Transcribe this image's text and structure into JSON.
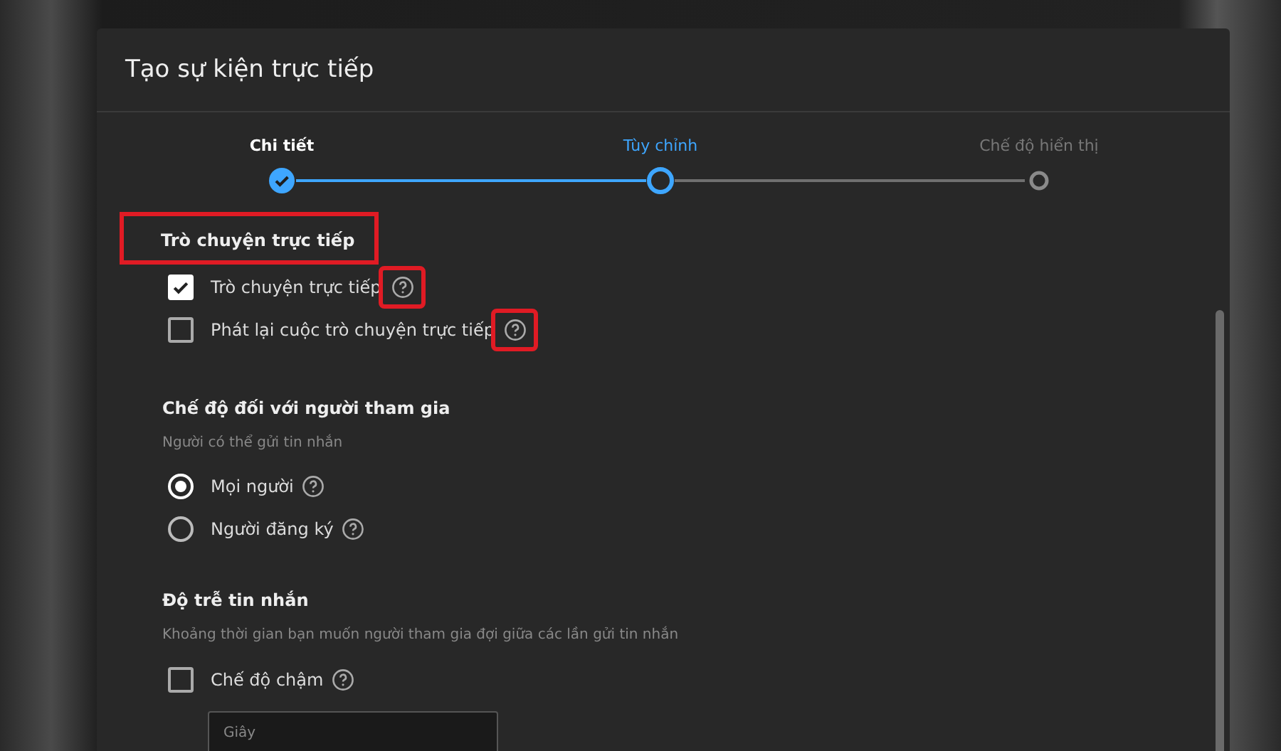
{
  "dialog": {
    "title": "Tạo sự kiện trực tiếp"
  },
  "steps": [
    {
      "label": "Chi tiết",
      "kind": "done"
    },
    {
      "label": "Tùy chỉnh",
      "kind": "current"
    },
    {
      "label": "Chế độ hiển thị",
      "kind": "pending"
    }
  ],
  "live_chat": {
    "title": "Trò chuyện trực tiếp",
    "highlighted": true,
    "options": [
      {
        "label": "Trò chuyện trực tiếp",
        "checked": true,
        "help_highlighted": true
      },
      {
        "label": "Phát lại cuộc trò chuyện trực tiếp",
        "checked": false,
        "help_highlighted": true
      }
    ]
  },
  "participant_mode": {
    "title": "Chế độ đối với người tham gia",
    "subtitle": "Người có thể gửi tin nhắn",
    "options": [
      {
        "label": "Mọi người",
        "selected": true
      },
      {
        "label": "Người đăng ký",
        "selected": false
      }
    ]
  },
  "message_delay": {
    "title": "Độ trễ tin nhắn",
    "subtitle": "Khoảng thời gian bạn muốn người tham gia đợi giữa các lần gửi tin nhắn",
    "slow_mode": {
      "label": "Chế độ chậm",
      "checked": false
    },
    "seconds_field": {
      "placeholder": "Giây"
    }
  }
}
